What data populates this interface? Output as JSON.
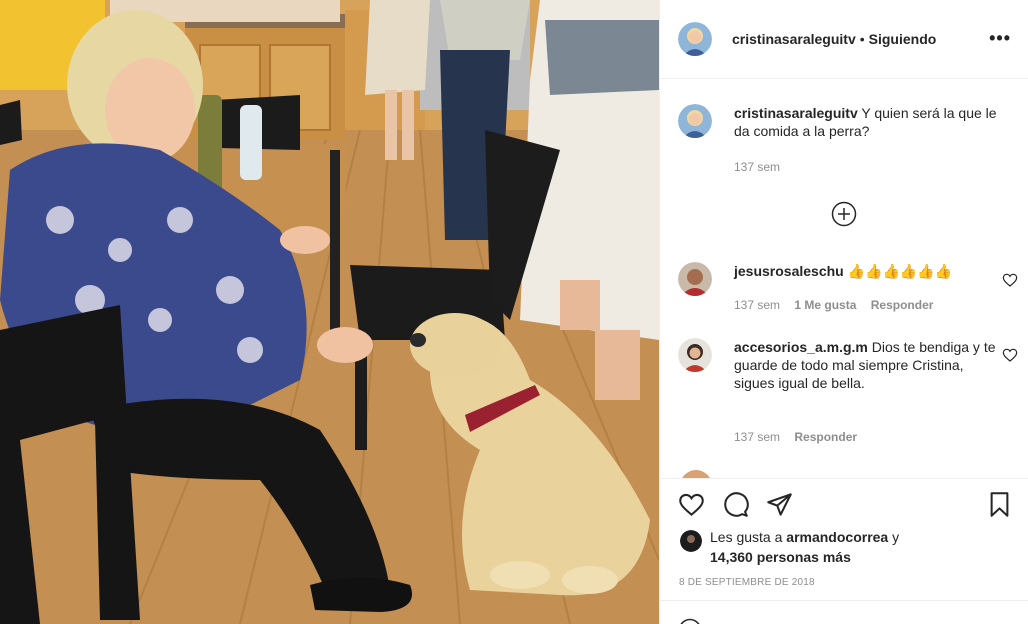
{
  "post": {
    "username": "cristinasaraleguitv",
    "separator": "•",
    "follow_status": "Siguiendo",
    "more_label": "•••"
  },
  "caption": {
    "username": "cristinasaraleguitv",
    "text": "Y quien será la que le da comida a la perra?",
    "time": "137 sem"
  },
  "comments": [
    {
      "username": "jesusrosaleschu",
      "text": "👍👍👍👍👍👍",
      "time": "137 sem",
      "likes": "1 Me gusta",
      "reply": "Responder"
    },
    {
      "username": "accesorios_a.m.g.m",
      "text": "Dios te bendiga y te guarde de todo mal siempre Cristina, sigues igual de bella.",
      "time": "137 sem",
      "reply": "Responder"
    }
  ],
  "likes_summary": {
    "prefix": "Les gusta a",
    "user": "armandocorrea",
    "connector": "y",
    "others": "14,360 personas más"
  },
  "date": "8 DE SEPTIEMBRE DE 2018",
  "icons": {
    "more": "more-options-icon",
    "load_more": "plus-circle-icon",
    "like": "heart-icon",
    "comment": "comment-bubble-icon",
    "share": "paper-plane-icon",
    "save": "bookmark-icon",
    "comment_like": "small-heart-icon"
  },
  "colors": {
    "text": "#262626",
    "secondary": "#8e8e8e",
    "border": "#efefef"
  }
}
